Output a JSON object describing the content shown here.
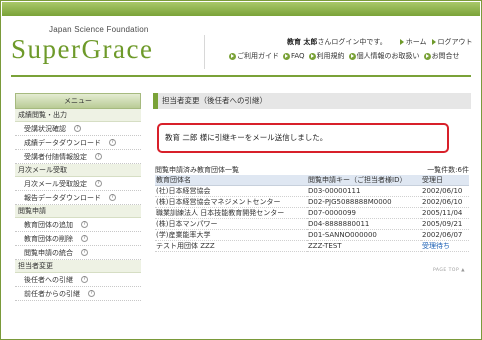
{
  "brand": {
    "sub": "Japan Science Foundation",
    "title": "SuperGrace"
  },
  "header": {
    "user_name": "教育  太郎",
    "user_msg": "さんログイン中です。",
    "home_label": "ホーム",
    "logout_label": "ログアウト",
    "nav": [
      {
        "label": "ご利用ガイド"
      },
      {
        "label": "FAQ"
      },
      {
        "label": "利用規約"
      },
      {
        "label": "個人情報のお取扱い"
      },
      {
        "label": "お問合せ"
      }
    ]
  },
  "sidebar": {
    "menu_label": "メニュー",
    "sections": [
      {
        "label": "成績閲覧・出力",
        "items": [
          "受講状況確認",
          "成績データダウンロード",
          "受講者付随情報設定"
        ]
      },
      {
        "label": "月次メール受取",
        "items": [
          "月次メール受取設定",
          "報告データダウンロード"
        ]
      },
      {
        "label": "閲覧申請",
        "items": [
          "教育団体の追加",
          "教育団体の削除",
          "閲覧申請の統合"
        ]
      },
      {
        "label": "担当者変更",
        "items": [
          "後任者への引継",
          "前任者からの引継"
        ]
      }
    ]
  },
  "main": {
    "title": "担当者変更（後任者への引継）",
    "notice": "教育  二郎 様に引継キーをメール送信しました。",
    "list_title": "閲覧申請済み教育団体一覧",
    "list_count": "一覧件数:6件",
    "columns": [
      "教育団体名",
      "閲覧申請キー（ご担当者様ID）",
      "受理日"
    ],
    "rows": [
      [
        "(社)日本経営協会",
        "D03-00000111",
        "2002/06/10"
      ],
      [
        "(株)日本経営協会マネジメントセンター",
        "D02-PJG5088888M0000",
        "2002/06/10"
      ],
      [
        "職業訓練法人 日本技能教育開発センター",
        "D07-0000099",
        "2005/11/04"
      ],
      [
        "(株)日本マンパワー",
        "D04-8888880011",
        "2005/09/21"
      ],
      [
        "(学)産業能率大学",
        "D01-SANNO000000",
        "2002/06/07"
      ],
      [
        "テスト用団体 ZZZ",
        "ZZZ-TEST",
        "受理待ち"
      ]
    ],
    "pagetop": "PAGE TOP ▲"
  }
}
